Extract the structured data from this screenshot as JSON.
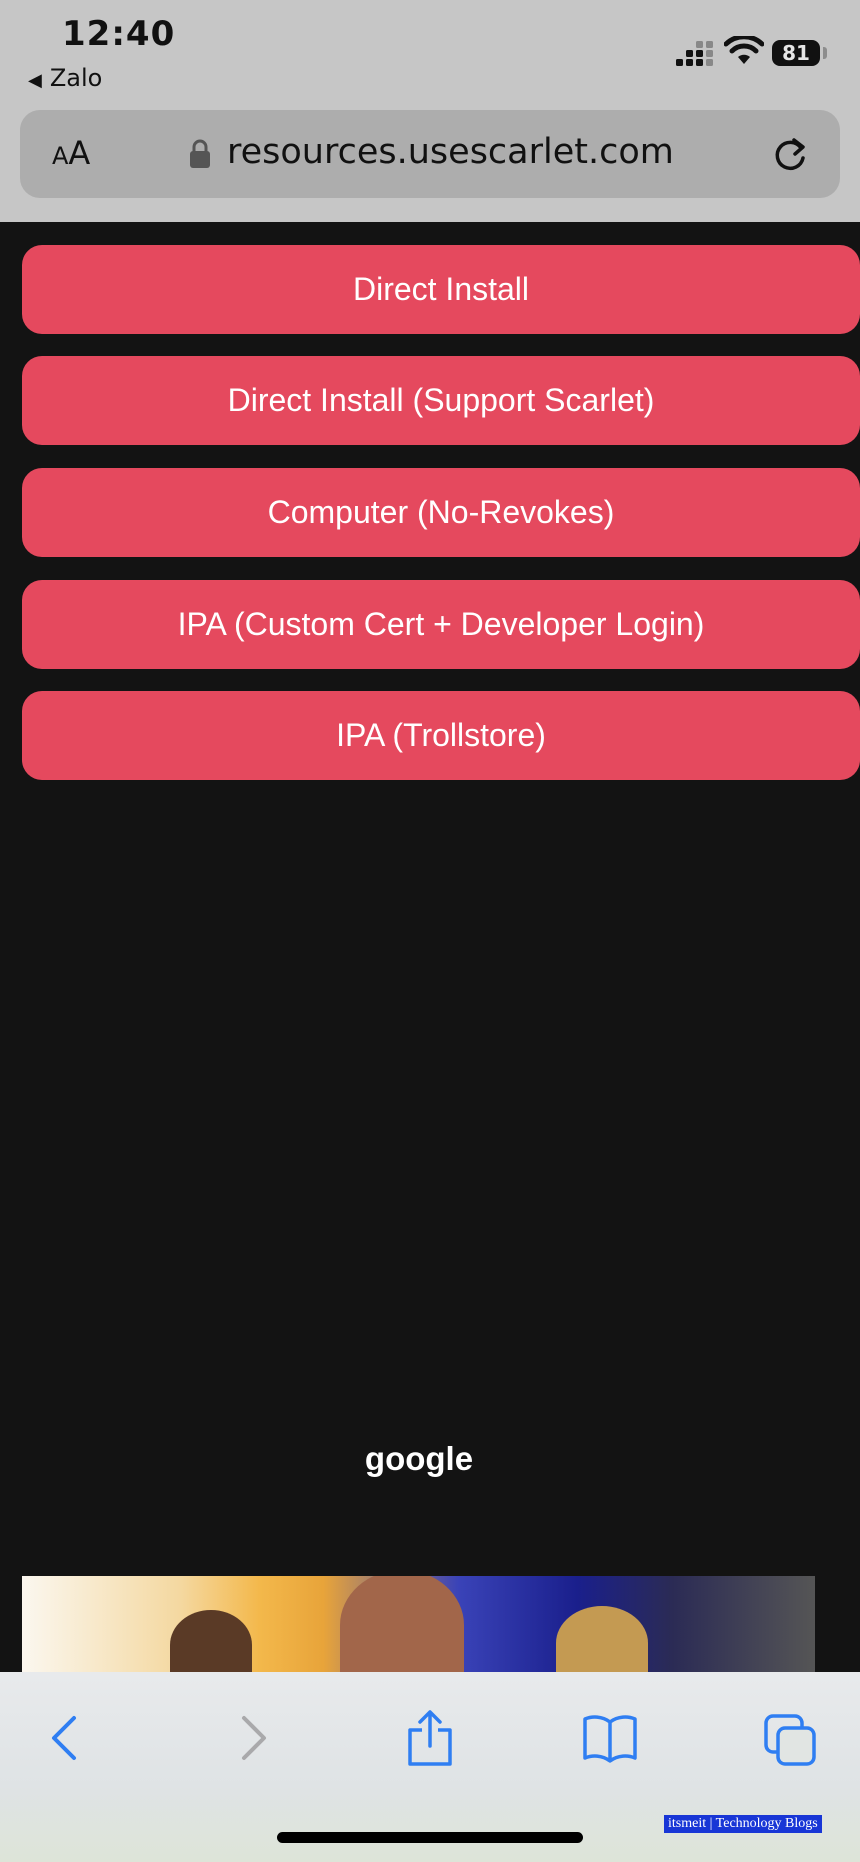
{
  "status_bar": {
    "time": "12:40",
    "back_app_label": "Zalo",
    "battery_level": "81"
  },
  "address_bar": {
    "reader_small": "A",
    "reader_big": "A",
    "url": "resources.usescarlet.com"
  },
  "buttons": [
    {
      "label": "Direct Install"
    },
    {
      "label": "Direct Install (Support Scarlet)"
    },
    {
      "label": "Computer (No-Revokes)"
    },
    {
      "label": "IPA (Custom Cert + Developer Login)"
    },
    {
      "label": "IPA (Trollstore)"
    }
  ],
  "ad_label": "google",
  "watermark": "itsmeit | Technology Blogs",
  "icons": [
    "lock-icon",
    "reload-icon",
    "back-icon",
    "forward-icon",
    "share-icon",
    "bookmarks-icon",
    "tabs-icon",
    "signal-icon",
    "wifi-icon",
    "battery-icon"
  ],
  "colors": {
    "button_bg": "#e5495e",
    "page_bg": "#131313",
    "chrome_bg": "#c6c6c6",
    "toolbar_icon_active": "#2f7ef2",
    "toolbar_icon_disabled": "#a9a9ab"
  }
}
